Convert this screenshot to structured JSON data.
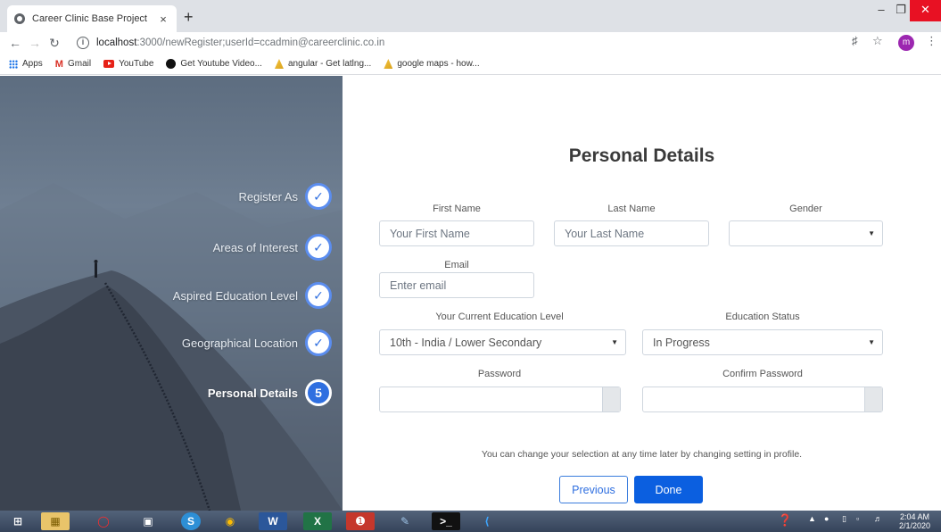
{
  "browser": {
    "tab_title": "Career Clinic Base Project",
    "tab_close": "×",
    "new_tab": "+",
    "url_host": "localhost",
    "url_path": ":3000/newRegister;userId=ccadmin@careerclinic.co.in",
    "avatar_letter": "m",
    "bookmarks": [
      {
        "label": "Apps",
        "icon": "apps-grid-icon"
      },
      {
        "label": "Gmail",
        "icon": "gmail-icon"
      },
      {
        "label": "YouTube",
        "icon": "youtube-icon"
      },
      {
        "label": "Get Youtube Video...",
        "icon": "github-icon"
      },
      {
        "label": "angular - Get latlng...",
        "icon": "stackoverflow-icon"
      },
      {
        "label": "google maps - how...",
        "icon": "stackoverflow-icon"
      }
    ]
  },
  "steps": [
    {
      "label": "Register As",
      "state": "done"
    },
    {
      "label": "Areas of Interest",
      "state": "done"
    },
    {
      "label": "Aspired Education Level",
      "state": "done"
    },
    {
      "label": "Geographical Location",
      "state": "done"
    },
    {
      "label": "Personal Details",
      "state": "active",
      "number": "5"
    }
  ],
  "check_mark": "✓",
  "form": {
    "title": "Personal Details",
    "first_name_label": "First Name",
    "first_name_placeholder": "Your First Name",
    "last_name_label": "Last Name",
    "last_name_placeholder": "Your Last Name",
    "gender_label": "Gender",
    "gender_value": "",
    "email_label": "Email",
    "email_placeholder": "Enter email",
    "education_level_label": "Your Current Education Level",
    "education_level_value": "10th - India / Lower Secondary",
    "education_status_label": "Education Status",
    "education_status_value": "In Progress",
    "password_label": "Password",
    "confirm_password_label": "Confirm Password",
    "note": "You can change your selection at any time later by changing setting in profile.",
    "previous_label": "Previous",
    "done_label": "Done"
  },
  "taskbar": {
    "clock_time": "2:04 AM",
    "clock_date": "2/1/2020"
  },
  "colors": {
    "accent": "#0b5fe0",
    "step_border": "#5b8def",
    "close_button": "#e81123"
  }
}
